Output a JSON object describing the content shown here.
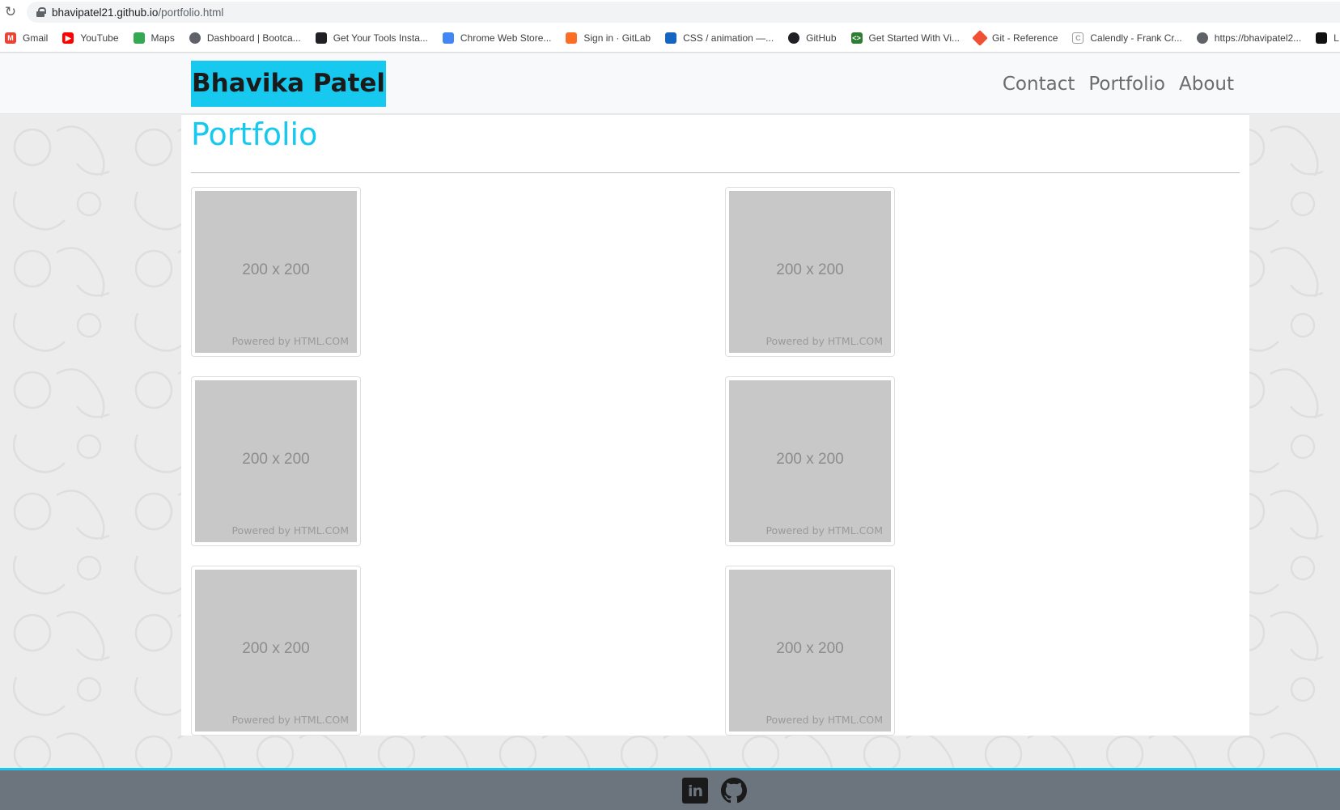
{
  "browser": {
    "url_host": "bhavipatel21.github.io",
    "url_path": "/portfolio.html",
    "bookmarks": [
      {
        "label": "Gmail",
        "icon": "gmail-icon",
        "color": "#ea4335"
      },
      {
        "label": "YouTube",
        "icon": "youtube-icon",
        "color": "#ff0000"
      },
      {
        "label": "Maps",
        "icon": "maps-icon",
        "color": "#34a853"
      },
      {
        "label": "Dashboard | Bootca...",
        "icon": "globe-icon",
        "color": "#5f6368"
      },
      {
        "label": "Get Your Tools Insta...",
        "icon": "book-icon",
        "color": "#202124"
      },
      {
        "label": "Chrome Web Store...",
        "icon": "chrome-store-icon",
        "color": "#4285f4"
      },
      {
        "label": "Sign in · GitLab",
        "icon": "gitlab-icon",
        "color": "#fc6d26"
      },
      {
        "label": "CSS / animation —...",
        "icon": "css-icon",
        "color": "#1565c0"
      },
      {
        "label": "GitHub",
        "icon": "github-icon",
        "color": "#202124"
      },
      {
        "label": "Get Started With Vi...",
        "icon": "code-icon",
        "color": "#2e7d32"
      },
      {
        "label": "Git - Reference",
        "icon": "git-icon",
        "color": "#f05033"
      },
      {
        "label": "Calendly - Frank Cr...",
        "icon": "calendly-icon",
        "color": "#9e9e9e"
      },
      {
        "label": "https://bhavipatel2...",
        "icon": "globe-icon",
        "color": "#5f6368"
      },
      {
        "label": "L",
        "icon": "app-icon",
        "color": "#111111"
      }
    ]
  },
  "nav": {
    "brand": "Bhavika Patel",
    "links": [
      "Contact",
      "Portfolio",
      "About"
    ]
  },
  "main": {
    "title": "Portfolio",
    "thumbnails": [
      {
        "dim": "200 x 200",
        "powered": "Powered by HTML.COM"
      },
      {
        "dim": "200 x 200",
        "powered": "Powered by HTML.COM"
      },
      {
        "dim": "200 x 200",
        "powered": "Powered by HTML.COM"
      },
      {
        "dim": "200 x 200",
        "powered": "Powered by HTML.COM"
      },
      {
        "dim": "200 x 200",
        "powered": "Powered by HTML.COM"
      },
      {
        "dim": "200 x 200",
        "powered": "Powered by HTML.COM"
      }
    ]
  },
  "footer": {
    "linkedin_icon": "linkedin-icon",
    "github_icon": "github-icon"
  },
  "colors": {
    "accent": "#17c9ee",
    "footer_bg": "#6c757d",
    "page_bg": "#ececec"
  }
}
